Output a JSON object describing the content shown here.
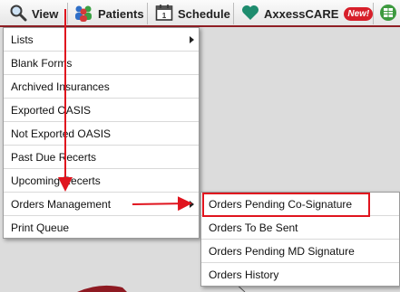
{
  "nav": {
    "view": "View",
    "patients": "Patients",
    "schedule": "Schedule",
    "axxesscare": "AxxessCARE",
    "new_badge": "New!"
  },
  "view_menu": {
    "items": [
      {
        "label": "Lists"
      },
      {
        "label": "Blank Forms"
      },
      {
        "label": "Archived Insurances"
      },
      {
        "label": "Exported OASIS"
      },
      {
        "label": "Not Exported OASIS"
      },
      {
        "label": "Past Due Recerts"
      },
      {
        "label": "Upcoming Recerts"
      },
      {
        "label": "Orders Management"
      },
      {
        "label": "Print Queue"
      }
    ]
  },
  "orders_submenu": {
    "items": [
      {
        "label": "Orders Pending Co-Signature"
      },
      {
        "label": "Orders To Be Sent"
      },
      {
        "label": "Orders Pending MD Signature"
      },
      {
        "label": "Orders History"
      }
    ]
  },
  "colors": {
    "annotation_red": "#e0141e",
    "nav_border": "#8f1e24",
    "badge_red": "#d71f2a"
  }
}
